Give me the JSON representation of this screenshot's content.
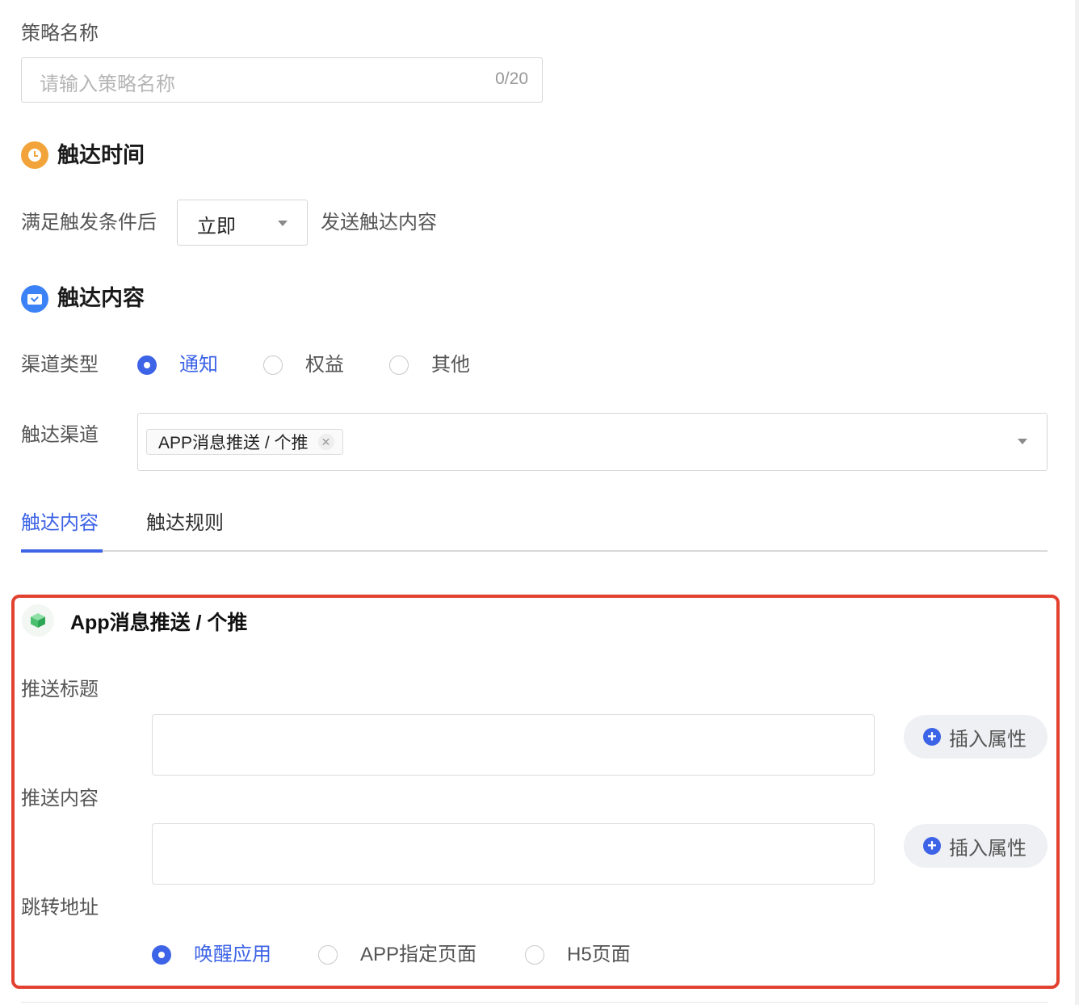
{
  "strategy": {
    "label": "策略名称",
    "placeholder": "请输入策略名称",
    "counter": "0/20"
  },
  "reach_time": {
    "heading": "触达时间",
    "prefix": "满足触发条件后",
    "select_value": "立即",
    "suffix": "发送触达内容"
  },
  "reach_content": {
    "heading": "触达内容",
    "channel_type_label": "渠道类型",
    "channel_types": [
      "通知",
      "权益",
      "其他"
    ],
    "channel_type_selected": "通知",
    "channel_label": "触达渠道",
    "channel_tag": "APP消息推送 / 个推"
  },
  "tabs": [
    "触达内容",
    "触达规则"
  ],
  "active_tab": "触达内容",
  "card": {
    "title": "App消息推送 / 个推",
    "push_title_label": "推送标题",
    "push_content_label": "推送内容",
    "insert_attr": "插入属性",
    "jump_label": "跳转地址",
    "jump_options": [
      "唤醒应用",
      "APP指定页面",
      "H5页面"
    ],
    "jump_selected": "唤醒应用"
  },
  "colors": {
    "primary": "#3d63e6",
    "highlight_border": "#e2412f",
    "clock_icon": "#f2a43a",
    "mail_icon": "#3b82f6",
    "cube_icon": "#5cc87a"
  }
}
